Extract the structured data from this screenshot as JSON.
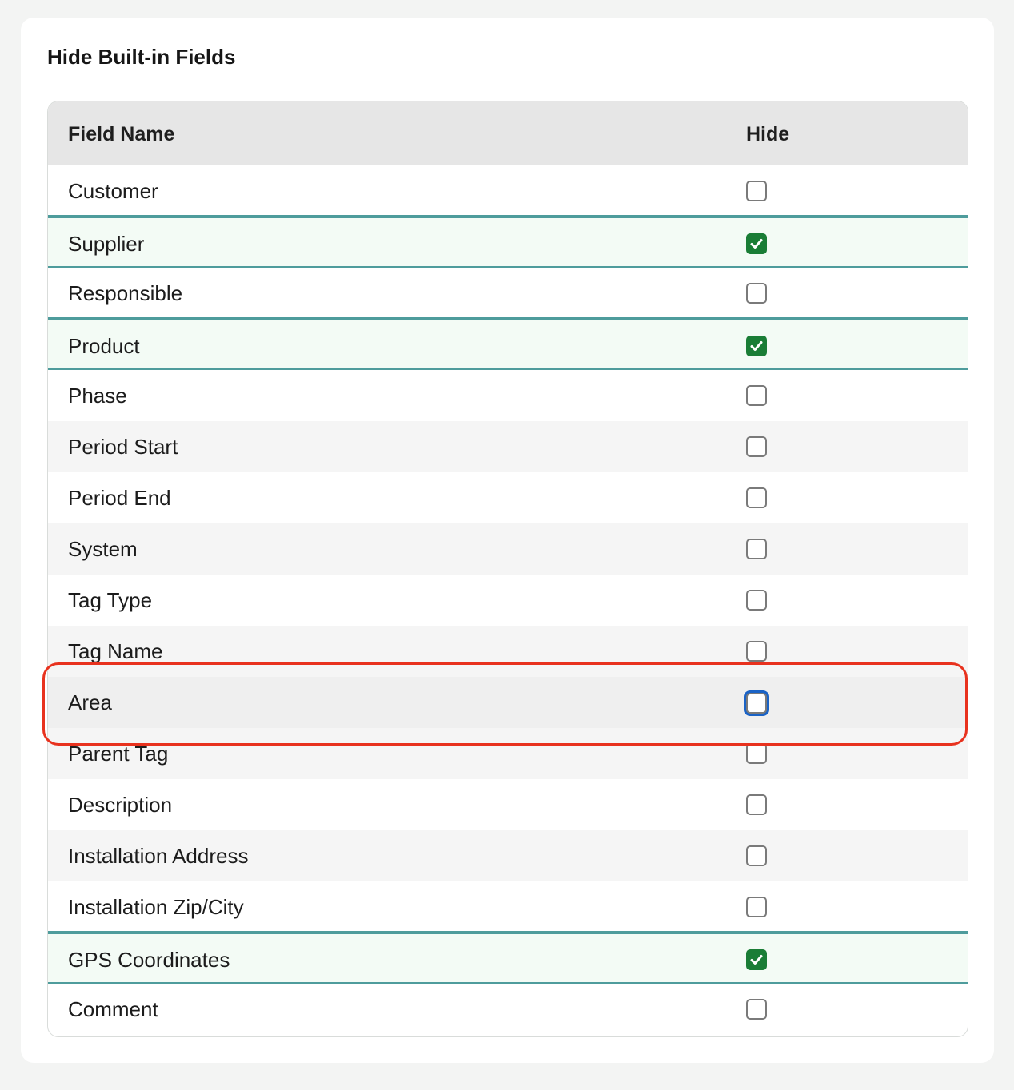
{
  "section": {
    "title": "Hide Built-in Fields"
  },
  "table": {
    "columns": {
      "field_name": "Field Name",
      "hide": "Hide"
    },
    "rows": [
      {
        "label": "Customer",
        "hidden": false
      },
      {
        "label": "Supplier",
        "hidden": true
      },
      {
        "label": "Responsible",
        "hidden": false
      },
      {
        "label": "Product",
        "hidden": true
      },
      {
        "label": "Phase",
        "hidden": false
      },
      {
        "label": "Period Start",
        "hidden": false
      },
      {
        "label": "Period End",
        "hidden": false
      },
      {
        "label": "System",
        "hidden": false
      },
      {
        "label": "Tag Type",
        "hidden": false
      },
      {
        "label": "Tag Name",
        "hidden": false
      },
      {
        "label": "Area",
        "hidden": false,
        "focused": true
      },
      {
        "label": "Parent Tag",
        "hidden": false
      },
      {
        "label": "Description",
        "hidden": false
      },
      {
        "label": "Installation Address",
        "hidden": false
      },
      {
        "label": "Installation Zip/City",
        "hidden": false
      },
      {
        "label": "GPS Coordinates",
        "hidden": true
      },
      {
        "label": "Comment",
        "hidden": false
      }
    ]
  },
  "colors": {
    "checked": "#1a7d36",
    "checked_row_border": "#4e9c9c",
    "focus_ring": "#1a63c6",
    "annotation_highlight": "#e8321e"
  },
  "icons": {
    "checkmark": "check-icon"
  }
}
